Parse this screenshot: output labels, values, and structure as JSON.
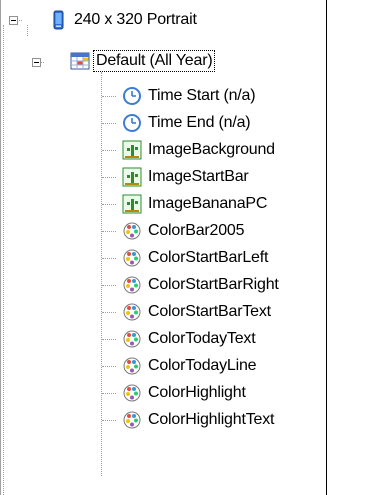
{
  "tree": {
    "root": {
      "label": "240 x 320 Portrait",
      "icon": "phone-device-icon"
    },
    "profile": {
      "label": "Default (All Year)",
      "icon": "calendar-table-icon"
    },
    "items": [
      {
        "label": "Time Start (n/a)",
        "icon": "clock-icon"
      },
      {
        "label": "Time End (n/a)",
        "icon": "clock-icon"
      },
      {
        "label": "ImageBackground",
        "icon": "image-cactus-icon"
      },
      {
        "label": "ImageStartBar",
        "icon": "image-cactus-icon"
      },
      {
        "label": "ImageBananaPC",
        "icon": "image-cactus-icon"
      },
      {
        "label": "ColorBar2005",
        "icon": "color-palette-icon"
      },
      {
        "label": "ColorStartBarLeft",
        "icon": "color-palette-icon"
      },
      {
        "label": "ColorStartBarRight",
        "icon": "color-palette-icon"
      },
      {
        "label": "ColorStartBarText",
        "icon": "color-palette-icon"
      },
      {
        "label": "ColorTodayText",
        "icon": "color-palette-icon"
      },
      {
        "label": "ColorTodayLine",
        "icon": "color-palette-icon"
      },
      {
        "label": "ColorHighlight",
        "icon": "color-palette-icon"
      },
      {
        "label": "ColorHighlightText",
        "icon": "color-palette-icon"
      }
    ]
  },
  "colors": {
    "tree_line": "#a0a0a0",
    "clock_blue": "#3a7bd5",
    "image_green": "#2e8b2e",
    "phone_blue": "#3b78e7"
  }
}
